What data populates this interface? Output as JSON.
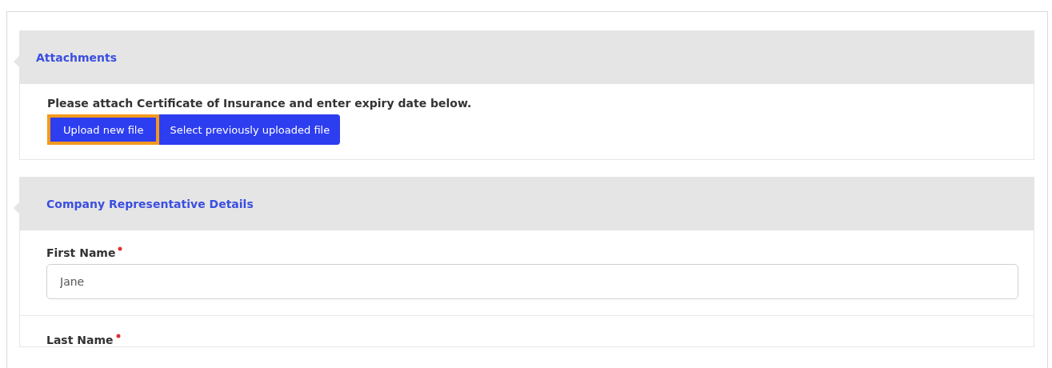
{
  "sections": [
    {
      "title": "Attachments",
      "kind": "attachments",
      "instruction": "Please attach Certificate of Insurance and enter expiry date below.",
      "buttons": [
        {
          "label": "Upload new file",
          "highlighted": true
        },
        {
          "label": "Select previously uploaded file",
          "highlighted": false
        }
      ]
    },
    {
      "title": "Company Representative Details",
      "kind": "fields",
      "fields": [
        {
          "label": "First Name",
          "required": true,
          "value": "Jane"
        },
        {
          "label": "Last Name",
          "required": true
        }
      ]
    }
  ]
}
